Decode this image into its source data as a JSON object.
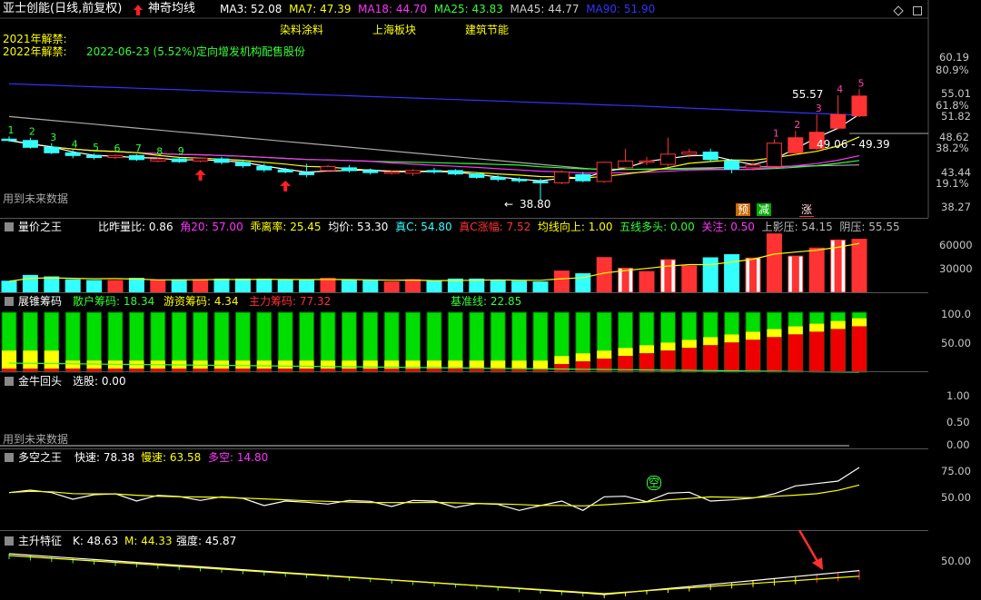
{
  "header": {
    "stock": "亚士创能(日线,前复权)",
    "indicator": "神奇均线",
    "ma": [
      {
        "label": "MA3: 52.08",
        "color": "#ffffff"
      },
      {
        "label": "MA7: 47.39",
        "color": "#ffff00"
      },
      {
        "label": "MA18: 44.70",
        "color": "#ff33ff"
      },
      {
        "label": "MA25: 43.83",
        "color": "#33ff33"
      },
      {
        "label": "MA45: 44.77",
        "color": "#cccccc"
      },
      {
        "label": "MA90: 51.90",
        "color": "#3333ff"
      }
    ],
    "sectors": [
      "染料涂料",
      "上海板块",
      "建筑节能"
    ]
  },
  "events": [
    {
      "year": "2021年解禁:",
      "desc": ""
    },
    {
      "year": "2022年解禁:",
      "desc": "2022-06-23 (5.52%)定向增发机构配售股份"
    }
  ],
  "main": {
    "y_ticks": [
      "60.19",
      "80.9%",
      "55.01",
      "61.8%",
      "51.82",
      "48.62",
      "38.2%",
      "43.44",
      "19.1%",
      "38.27"
    ],
    "high_label": "55.57",
    "low_label": "38.80",
    "range_label": "49.06 - 49.39",
    "future_note": "用到未来数据",
    "counts": [
      "1",
      "2",
      "3",
      "4",
      "5",
      "6",
      "7",
      "8",
      "9",
      "1",
      "2",
      "3",
      "4",
      "5"
    ],
    "signals": [
      {
        "text": "预",
        "bg": "#cc6600"
      },
      {
        "text": "减",
        "bg": "#00aa00"
      },
      {
        "text": "涨",
        "bg": "#ff3333"
      }
    ]
  },
  "volume": {
    "title": "量价之王",
    "stats": [
      {
        "label": "比昨量比: 0.86",
        "color": "#ffffff"
      },
      {
        "label": "角20: 57.00",
        "color": "#ff33ff"
      },
      {
        "label": "乖离率: 25.45",
        "color": "#ffff00"
      },
      {
        "label": "均价: 53.30",
        "color": "#ffffff"
      },
      {
        "label": "真C: 54.80",
        "color": "#33ffff"
      },
      {
        "label": "真C涨幅: 7.52",
        "color": "#ff3333"
      },
      {
        "label": "均线向上: 1.00",
        "color": "#ffff00"
      },
      {
        "label": "五线多头: 0.00",
        "color": "#33ff33"
      },
      {
        "label": "关注: 0.50",
        "color": "#ff33ff"
      },
      {
        "label": "上影压: 54.15",
        "color": "#bbbbbb"
      },
      {
        "label": "阴压: 55.55",
        "color": "#bbbbbb"
      }
    ],
    "y_ticks": [
      "60000",
      "30000"
    ]
  },
  "chips": {
    "title": "展锥筹码",
    "stats": [
      {
        "label": "散户筹码: 18.34",
        "color": "#33ff33"
      },
      {
        "label": "游资筹码: 4.34",
        "color": "#ffff00"
      },
      {
        "label": "主力筹码: 77.32",
        "color": "#ff3333"
      },
      {
        "label": "基准线: 22.85",
        "color": "#33ff33"
      }
    ],
    "y_ticks": [
      "100.0",
      "50.00"
    ]
  },
  "bull": {
    "title": "金牛回头",
    "stats": [
      {
        "label": "选股: 0.00",
        "color": "#ffffff"
      }
    ],
    "y_ticks": [
      "1.00",
      "0.50",
      "0.00"
    ],
    "future_note": "用到未来数据"
  },
  "longshort": {
    "title": "多空之王",
    "stats": [
      {
        "label": "快速: 78.38",
        "color": "#ffffff"
      },
      {
        "label": "慢速: 63.58",
        "color": "#ffff00"
      },
      {
        "label": "多空: 14.80",
        "color": "#ff33ff"
      }
    ],
    "y_ticks": [
      "75.00",
      "50.00"
    ],
    "kong": "空"
  },
  "rise": {
    "title": "主升特征",
    "stats": [
      {
        "label": "K: 48.63",
        "color": "#ffffff"
      },
      {
        "label": "M: 44.33",
        "color": "#ffff00"
      },
      {
        "label": "强度: 45.87",
        "color": "#ffffff"
      }
    ],
    "y_ticks": [
      "50.00"
    ]
  },
  "chart_data": {
    "type": "candlestick",
    "note": "approximate daily OHLC read from the chart (left to right)",
    "candles": [
      [
        48.2,
        48.6,
        48.0,
        47.8
      ],
      [
        48.0,
        48.4,
        47.0,
        46.8
      ],
      [
        47.0,
        47.6,
        46.2,
        46.0
      ],
      [
        46.2,
        46.6,
        45.8,
        45.4
      ],
      [
        45.8,
        46.1,
        45.5,
        45.2
      ],
      [
        45.5,
        46.0,
        45.8,
        45.3
      ],
      [
        45.8,
        46.0,
        45.2,
        45.0
      ],
      [
        45.0,
        45.5,
        45.3,
        44.8
      ],
      [
        45.3,
        45.6,
        44.9,
        44.7
      ],
      [
        45.0,
        45.4,
        45.4,
        44.8
      ],
      [
        45.3,
        45.6,
        44.8,
        44.5
      ],
      [
        44.8,
        45.2,
        44.3,
        44.0
      ],
      [
        44.2,
        44.6,
        43.7,
        43.4
      ],
      [
        43.7,
        44.0,
        43.4,
        43.2
      ],
      [
        43.3,
        44.6,
        43.0,
        42.6
      ],
      [
        43.6,
        44.4,
        44.2,
        43.4
      ],
      [
        44.0,
        44.4,
        43.6,
        43.3
      ],
      [
        43.6,
        43.9,
        43.3,
        43.0
      ],
      [
        43.3,
        43.6,
        43.4,
        43.0
      ],
      [
        43.2,
        43.8,
        43.6,
        42.8
      ],
      [
        43.6,
        44.0,
        43.4,
        43.1
      ],
      [
        43.6,
        43.8,
        43.1,
        42.9
      ],
      [
        43.1,
        43.4,
        42.6,
        42.4
      ],
      [
        42.6,
        42.9,
        42.3,
        42.0
      ],
      [
        42.3,
        42.6,
        42.1,
        41.8
      ],
      [
        42.0,
        42.4,
        41.9,
        39.2
      ],
      [
        41.8,
        43.6,
        43.4,
        41.6
      ],
      [
        43.0,
        43.4,
        42.1,
        41.9
      ],
      [
        42.0,
        44.9,
        44.8,
        41.8
      ],
      [
        44.0,
        46.8,
        45.0,
        43.8
      ],
      [
        44.8,
        45.6,
        45.0,
        44.4
      ],
      [
        44.5,
        48.4,
        46.0,
        44.2
      ],
      [
        46.0,
        46.8,
        46.3,
        45.5
      ],
      [
        46.3,
        46.8,
        45.2,
        44.9
      ],
      [
        45.0,
        45.3,
        43.8,
        43.2
      ],
      [
        44.0,
        44.8,
        44.4,
        43.6
      ],
      [
        44.2,
        48.2,
        47.6,
        44.0
      ],
      [
        46.2,
        49.4,
        48.4,
        45.8
      ],
      [
        46.8,
        51.8,
        49.2,
        46.6
      ],
      [
        49.8,
        54.6,
        51.8,
        49.6
      ],
      [
        51.6,
        55.5,
        54.5,
        51.4
      ]
    ]
  }
}
